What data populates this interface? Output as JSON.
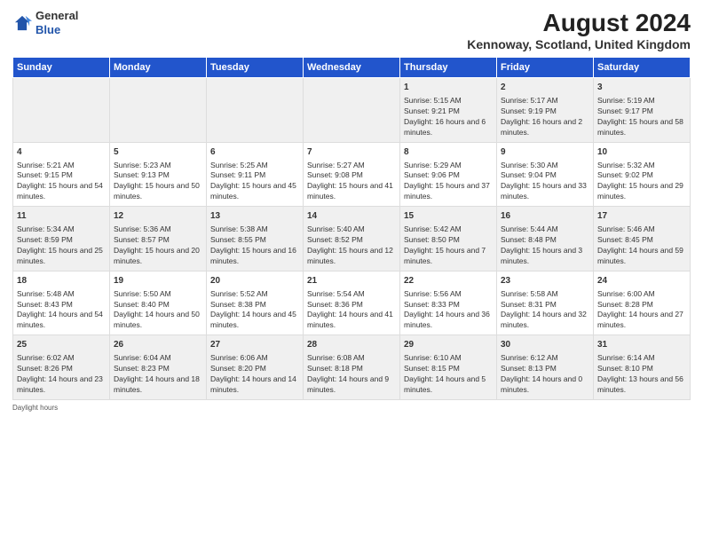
{
  "logo": {
    "general": "General",
    "blue": "Blue"
  },
  "header": {
    "title": "August 2024",
    "subtitle": "Kennoway, Scotland, United Kingdom"
  },
  "days": [
    "Sunday",
    "Monday",
    "Tuesday",
    "Wednesday",
    "Thursday",
    "Friday",
    "Saturday"
  ],
  "weeks": [
    [
      {
        "num": "",
        "sunrise": "",
        "sunset": "",
        "daylight": ""
      },
      {
        "num": "",
        "sunrise": "",
        "sunset": "",
        "daylight": ""
      },
      {
        "num": "",
        "sunrise": "",
        "sunset": "",
        "daylight": ""
      },
      {
        "num": "",
        "sunrise": "",
        "sunset": "",
        "daylight": ""
      },
      {
        "num": "1",
        "sunrise": "Sunrise: 5:15 AM",
        "sunset": "Sunset: 9:21 PM",
        "daylight": "Daylight: 16 hours and 6 minutes."
      },
      {
        "num": "2",
        "sunrise": "Sunrise: 5:17 AM",
        "sunset": "Sunset: 9:19 PM",
        "daylight": "Daylight: 16 hours and 2 minutes."
      },
      {
        "num": "3",
        "sunrise": "Sunrise: 5:19 AM",
        "sunset": "Sunset: 9:17 PM",
        "daylight": "Daylight: 15 hours and 58 minutes."
      }
    ],
    [
      {
        "num": "4",
        "sunrise": "Sunrise: 5:21 AM",
        "sunset": "Sunset: 9:15 PM",
        "daylight": "Daylight: 15 hours and 54 minutes."
      },
      {
        "num": "5",
        "sunrise": "Sunrise: 5:23 AM",
        "sunset": "Sunset: 9:13 PM",
        "daylight": "Daylight: 15 hours and 50 minutes."
      },
      {
        "num": "6",
        "sunrise": "Sunrise: 5:25 AM",
        "sunset": "Sunset: 9:11 PM",
        "daylight": "Daylight: 15 hours and 45 minutes."
      },
      {
        "num": "7",
        "sunrise": "Sunrise: 5:27 AM",
        "sunset": "Sunset: 9:08 PM",
        "daylight": "Daylight: 15 hours and 41 minutes."
      },
      {
        "num": "8",
        "sunrise": "Sunrise: 5:29 AM",
        "sunset": "Sunset: 9:06 PM",
        "daylight": "Daylight: 15 hours and 37 minutes."
      },
      {
        "num": "9",
        "sunrise": "Sunrise: 5:30 AM",
        "sunset": "Sunset: 9:04 PM",
        "daylight": "Daylight: 15 hours and 33 minutes."
      },
      {
        "num": "10",
        "sunrise": "Sunrise: 5:32 AM",
        "sunset": "Sunset: 9:02 PM",
        "daylight": "Daylight: 15 hours and 29 minutes."
      }
    ],
    [
      {
        "num": "11",
        "sunrise": "Sunrise: 5:34 AM",
        "sunset": "Sunset: 8:59 PM",
        "daylight": "Daylight: 15 hours and 25 minutes."
      },
      {
        "num": "12",
        "sunrise": "Sunrise: 5:36 AM",
        "sunset": "Sunset: 8:57 PM",
        "daylight": "Daylight: 15 hours and 20 minutes."
      },
      {
        "num": "13",
        "sunrise": "Sunrise: 5:38 AM",
        "sunset": "Sunset: 8:55 PM",
        "daylight": "Daylight: 15 hours and 16 minutes."
      },
      {
        "num": "14",
        "sunrise": "Sunrise: 5:40 AM",
        "sunset": "Sunset: 8:52 PM",
        "daylight": "Daylight: 15 hours and 12 minutes."
      },
      {
        "num": "15",
        "sunrise": "Sunrise: 5:42 AM",
        "sunset": "Sunset: 8:50 PM",
        "daylight": "Daylight: 15 hours and 7 minutes."
      },
      {
        "num": "16",
        "sunrise": "Sunrise: 5:44 AM",
        "sunset": "Sunset: 8:48 PM",
        "daylight": "Daylight: 15 hours and 3 minutes."
      },
      {
        "num": "17",
        "sunrise": "Sunrise: 5:46 AM",
        "sunset": "Sunset: 8:45 PM",
        "daylight": "Daylight: 14 hours and 59 minutes."
      }
    ],
    [
      {
        "num": "18",
        "sunrise": "Sunrise: 5:48 AM",
        "sunset": "Sunset: 8:43 PM",
        "daylight": "Daylight: 14 hours and 54 minutes."
      },
      {
        "num": "19",
        "sunrise": "Sunrise: 5:50 AM",
        "sunset": "Sunset: 8:40 PM",
        "daylight": "Daylight: 14 hours and 50 minutes."
      },
      {
        "num": "20",
        "sunrise": "Sunrise: 5:52 AM",
        "sunset": "Sunset: 8:38 PM",
        "daylight": "Daylight: 14 hours and 45 minutes."
      },
      {
        "num": "21",
        "sunrise": "Sunrise: 5:54 AM",
        "sunset": "Sunset: 8:36 PM",
        "daylight": "Daylight: 14 hours and 41 minutes."
      },
      {
        "num": "22",
        "sunrise": "Sunrise: 5:56 AM",
        "sunset": "Sunset: 8:33 PM",
        "daylight": "Daylight: 14 hours and 36 minutes."
      },
      {
        "num": "23",
        "sunrise": "Sunrise: 5:58 AM",
        "sunset": "Sunset: 8:31 PM",
        "daylight": "Daylight: 14 hours and 32 minutes."
      },
      {
        "num": "24",
        "sunrise": "Sunrise: 6:00 AM",
        "sunset": "Sunset: 8:28 PM",
        "daylight": "Daylight: 14 hours and 27 minutes."
      }
    ],
    [
      {
        "num": "25",
        "sunrise": "Sunrise: 6:02 AM",
        "sunset": "Sunset: 8:26 PM",
        "daylight": "Daylight: 14 hours and 23 minutes."
      },
      {
        "num": "26",
        "sunrise": "Sunrise: 6:04 AM",
        "sunset": "Sunset: 8:23 PM",
        "daylight": "Daylight: 14 hours and 18 minutes."
      },
      {
        "num": "27",
        "sunrise": "Sunrise: 6:06 AM",
        "sunset": "Sunset: 8:20 PM",
        "daylight": "Daylight: 14 hours and 14 minutes."
      },
      {
        "num": "28",
        "sunrise": "Sunrise: 6:08 AM",
        "sunset": "Sunset: 8:18 PM",
        "daylight": "Daylight: 14 hours and 9 minutes."
      },
      {
        "num": "29",
        "sunrise": "Sunrise: 6:10 AM",
        "sunset": "Sunset: 8:15 PM",
        "daylight": "Daylight: 14 hours and 5 minutes."
      },
      {
        "num": "30",
        "sunrise": "Sunrise: 6:12 AM",
        "sunset": "Sunset: 8:13 PM",
        "daylight": "Daylight: 14 hours and 0 minutes."
      },
      {
        "num": "31",
        "sunrise": "Sunrise: 6:14 AM",
        "sunset": "Sunset: 8:10 PM",
        "daylight": "Daylight: 13 hours and 56 minutes."
      }
    ]
  ],
  "footer": {
    "text": "Daylight hours"
  }
}
